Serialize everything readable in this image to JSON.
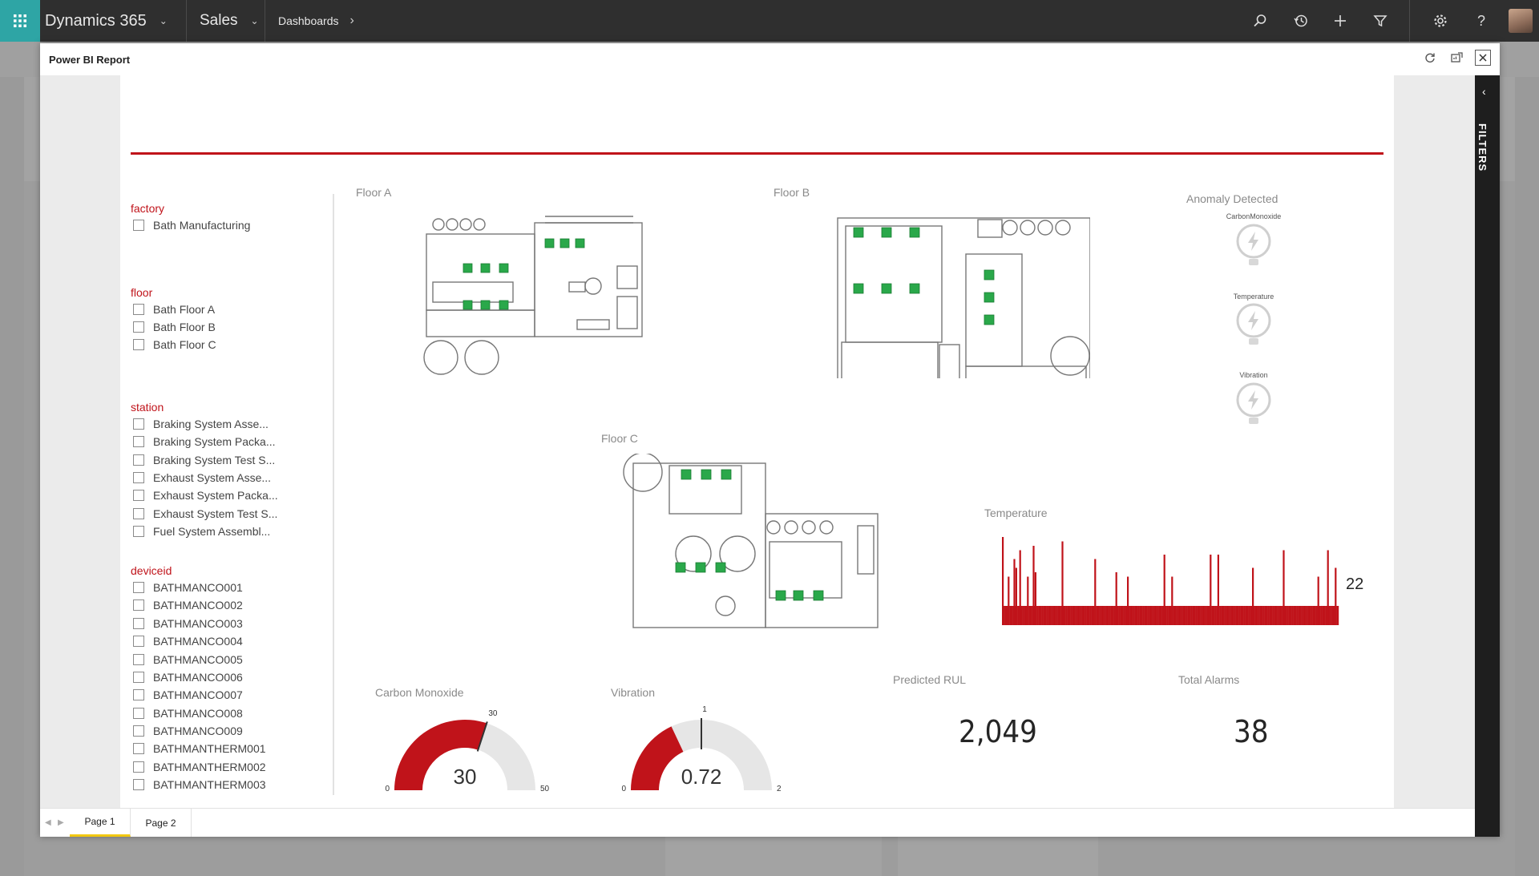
{
  "nav": {
    "app_name": "Dynamics 365",
    "area": "Sales",
    "breadcrumb": "Dashboards"
  },
  "dialog": {
    "title": "Power BI Report"
  },
  "filters_pane": {
    "label": "FILTERS"
  },
  "slicers": {
    "factory": {
      "title": "factory",
      "items": [
        "Bath Manufacturing"
      ]
    },
    "floor": {
      "title": "floor",
      "items": [
        "Bath Floor A",
        "Bath Floor B",
        "Bath Floor C"
      ]
    },
    "station": {
      "title": "station",
      "items": [
        "Braking System Asse...",
        "Braking System Packa...",
        "Braking System Test S...",
        "Exhaust System Asse...",
        "Exhaust System Packa...",
        "Exhaust System Test S...",
        "Fuel System Assembl..."
      ]
    },
    "deviceid": {
      "title": "deviceid",
      "items": [
        "BATHMANCO001",
        "BATHMANCO002",
        "BATHMANCO003",
        "BATHMANCO004",
        "BATHMANCO005",
        "BATHMANCO006",
        "BATHMANCO007",
        "BATHMANCO008",
        "BATHMANCO009",
        "BATHMANTHERM001",
        "BATHMANTHERM002",
        "BATHMANTHERM003"
      ]
    }
  },
  "visuals": {
    "floor_a": {
      "title": "Floor A"
    },
    "floor_b": {
      "title": "Floor B"
    },
    "floor_c": {
      "title": "Floor C"
    },
    "anomaly": {
      "title": "Anomaly Detected",
      "labels": [
        "CarbonMonoxide",
        "Temperature",
        "Vibration"
      ]
    },
    "temperature": {
      "title": "Temperature",
      "last_value": "22"
    },
    "predicted_rul": {
      "title": "Predicted RUL",
      "value": "2,049"
    },
    "total_alarms": {
      "title": "Total Alarms",
      "value": "38"
    },
    "carbon_monoxide": {
      "title": "Carbon Monoxide",
      "value": "30",
      "min": "0",
      "max": "50",
      "target": "30"
    },
    "vibration": {
      "title": "Vibration",
      "value": "0.72",
      "min": "0",
      "max": "2",
      "target": "1"
    }
  },
  "chart_data": [
    {
      "type": "gauge",
      "title": "Carbon Monoxide",
      "value": 30,
      "min": 0,
      "max": 50,
      "target": 30
    },
    {
      "type": "gauge",
      "title": "Vibration",
      "value": 0.72,
      "min": 0,
      "max": 2,
      "target": 1
    },
    {
      "type": "bar",
      "title": "Temperature",
      "values": [
        20,
        48,
        20,
        20,
        22,
        20,
        40,
        20,
        44,
        20,
        20,
        20,
        60,
        20,
        20,
        20,
        20,
        20,
        20,
        20,
        20,
        20,
        52,
        20,
        20,
        20,
        20,
        20,
        20,
        20,
        20,
        20,
        20,
        20,
        20,
        20,
        20,
        20,
        20,
        20,
        20,
        20,
        20,
        20,
        20,
        20,
        20,
        20,
        20,
        20,
        20,
        20,
        20,
        20,
        20,
        20,
        20,
        20,
        20,
        20,
        58,
        20,
        20,
        20,
        20,
        20,
        20,
        20,
        20,
        20,
        20,
        20,
        20,
        20,
        20,
        20,
        20,
        20,
        20,
        20,
        20,
        20,
        20,
        20,
        20,
        20,
        20,
        20,
        20,
        20,
        20,
        20,
        20,
        20,
        20,
        20,
        20,
        20,
        20,
        20,
        20,
        20,
        20,
        20,
        20,
        20,
        20,
        20,
        20,
        20,
        20,
        20,
        20,
        20,
        20,
        20,
        20,
        20,
        20,
        20,
        20,
        20,
        20,
        20,
        20,
        20,
        20,
        20,
        20,
        20,
        20,
        20,
        20,
        20,
        20,
        20,
        20,
        20,
        20,
        20,
        20,
        20,
        20,
        20,
        20,
        20,
        22
      ],
      "spikes": [
        [
          0,
          1.0
        ],
        [
          6,
          0.55
        ],
        [
          12,
          0.75
        ],
        [
          14,
          0.65
        ],
        [
          18,
          0.85
        ],
        [
          26,
          0.55
        ],
        [
          32,
          0.9
        ],
        [
          34,
          0.6
        ],
        [
          62,
          0.95
        ],
        [
          96,
          0.75
        ],
        [
          118,
          0.6
        ],
        [
          130,
          0.55
        ],
        [
          168,
          0.8
        ],
        [
          176,
          0.55
        ],
        [
          216,
          0.8
        ],
        [
          224,
          0.8
        ],
        [
          260,
          0.65
        ],
        [
          292,
          0.85
        ],
        [
          328,
          0.55
        ],
        [
          338,
          0.85
        ],
        [
          346,
          0.65
        ]
      ],
      "last_value": 22
    }
  ],
  "pages": {
    "tabs": [
      "Page 1",
      "Page 2"
    ],
    "active": 0
  }
}
